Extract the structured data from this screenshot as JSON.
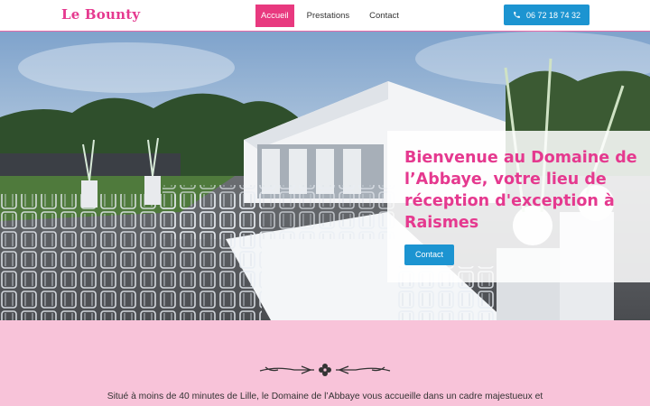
{
  "header": {
    "logo": "Le Bounty",
    "nav": [
      {
        "label": "Accueil",
        "active": true
      },
      {
        "label": "Prestations",
        "active": false
      },
      {
        "label": "Contact",
        "active": false
      }
    ],
    "phone": "06 72 18 74 32",
    "phone_icon": "phone-icon"
  },
  "hero": {
    "title": "Bienvenue au Domaine de l’Abbaye, votre lieu de réception d'exception à Raismes",
    "button": "Contact"
  },
  "intro": {
    "ornament_icon": "flourish-ornament",
    "text_line1": "Situé à moins de 40 minutes de Lille, le Domaine de l’Abbaye vous accueille dans un cadre majestueux et"
  },
  "colors": {
    "brand_pink": "#e5398f",
    "button_blue": "#1c94d1",
    "section_pink": "#f8c3d9"
  }
}
